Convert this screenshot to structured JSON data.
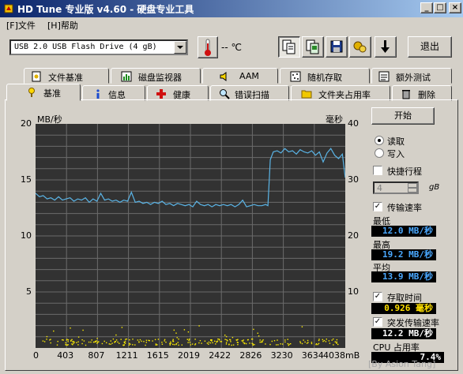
{
  "window": {
    "title": "HD Tune 专业版 v4.60 - 硬盘专业工具",
    "min_label": "_",
    "max_label": "□",
    "close_label": "×"
  },
  "menu": [
    "[F]文件",
    "[H]帮助"
  ],
  "toolbar": {
    "drive_value": "USB 2.0 USB Flash Drive  (4 gB)",
    "temperature": "-- ℃",
    "exit_label": "退出",
    "icons": [
      "copy-text-icon",
      "copy-screen-icon",
      "save-icon",
      "options-icon",
      "download-arrow-icon"
    ]
  },
  "tabs_top": [
    {
      "label": "文件基准",
      "icon": "file-benchmark-icon"
    },
    {
      "label": "磁盘监视器",
      "icon": "disk-monitor-icon"
    },
    {
      "label": "AAM",
      "icon": "speaker-icon"
    },
    {
      "label": "随机存取",
      "icon": "random-access-icon"
    },
    {
      "label": "额外测试",
      "icon": "extra-tests-icon"
    }
  ],
  "tabs_bottom": [
    {
      "label": "基准",
      "icon": "benchmark-icon",
      "active": true
    },
    {
      "label": "信息",
      "icon": "info-icon"
    },
    {
      "label": "健康",
      "icon": "health-cross-icon"
    },
    {
      "label": "错误扫描",
      "icon": "magnifier-icon"
    },
    {
      "label": "文件夹占用率",
      "icon": "folder-icon"
    },
    {
      "label": "删除",
      "icon": "trash-icon"
    }
  ],
  "chart_data": {
    "type": "line",
    "left_axis_label": "MB/秒",
    "right_axis_label": "毫秒",
    "left_ticks": [
      "20",
      "15",
      "10",
      "5"
    ],
    "right_ticks": [
      "40",
      "30",
      "20",
      "10"
    ],
    "ylim_left": [
      0,
      20
    ],
    "ylim_right": [
      0,
      40
    ],
    "x_ticks": [
      "0",
      "403",
      "807",
      "1211",
      "1615",
      "2019",
      "2422",
      "2826",
      "3230",
      "3634",
      "4038mB"
    ],
    "xlim": [
      0,
      4038
    ],
    "series": [
      {
        "name": "传输速率",
        "color": "#5ab4e6",
        "x": [
          0,
          50,
          100,
          150,
          200,
          250,
          300,
          350,
          400,
          450,
          500,
          550,
          600,
          650,
          700,
          750,
          800,
          850,
          900,
          950,
          1000,
          1050,
          1100,
          1150,
          1200,
          1250,
          1300,
          1350,
          1400,
          1450,
          1500,
          1550,
          1600,
          1650,
          1700,
          1750,
          1800,
          1850,
          1900,
          1950,
          2000,
          2050,
          2100,
          2150,
          2200,
          2250,
          2300,
          2350,
          2400,
          2450,
          2500,
          2550,
          2600,
          2650,
          2700,
          2750,
          2800,
          2850,
          2900,
          2950,
          3000,
          3030,
          3060,
          3100,
          3150,
          3200,
          3250,
          3300,
          3350,
          3400,
          3450,
          3500,
          3550,
          3600,
          3650,
          3700,
          3750,
          3800,
          3850,
          3900,
          3950,
          4000,
          4038
        ],
        "y": [
          13.8,
          13.5,
          13.6,
          13.3,
          13.4,
          13.2,
          13.5,
          13.2,
          13.3,
          13.4,
          13.1,
          13.3,
          13.2,
          13.4,
          13.0,
          13.3,
          13.1,
          13.8,
          13.2,
          13.3,
          13.1,
          13.2,
          13.0,
          13.2,
          13.1,
          13.9,
          13.0,
          13.1,
          12.9,
          13.0,
          12.8,
          13.0,
          12.9,
          13.1,
          12.8,
          12.9,
          12.7,
          12.9,
          12.8,
          12.7,
          12.8,
          12.6,
          13.1,
          12.8,
          12.7,
          12.8,
          12.6,
          12.8,
          12.7,
          12.8,
          12.7,
          12.8,
          12.6,
          12.8,
          13.2,
          12.6,
          12.7,
          12.8,
          12.7,
          12.7,
          12.8,
          12.7,
          16.8,
          17.5,
          17.6,
          17.4,
          17.8,
          17.5,
          17.6,
          17.3,
          17.7,
          17.5,
          17.4,
          17.6,
          17.2,
          17.5,
          16.6,
          17.4,
          17.8,
          17.2,
          16.9,
          17.3,
          15.2
        ]
      }
    ],
    "access_time_dots_ms": "near 0.9 ms, along the bottom"
  },
  "controls": {
    "start_label": "开始",
    "read_label": "读取",
    "write_label": "写入",
    "mode": "read",
    "short_stroke_label": "快捷行程",
    "short_stroke_checked": false,
    "short_stroke_value": "4",
    "short_stroke_unit": "gB",
    "transfer_rate_label": "传输速率",
    "transfer_rate_checked": true,
    "min_label": "最低",
    "min_value": "12.0 MB/秒",
    "max_label": "最高",
    "max_value": "19.2 MB/秒",
    "avg_label": "平均",
    "avg_value": "13.9 MB/秒",
    "access_time_label": "存取时间",
    "access_time_checked": true,
    "access_time_value": "0.926 毫秒",
    "burst_label": "突发传输速率",
    "burst_checked": true,
    "burst_value": "12.2 MB/秒",
    "cpu_label": "CPU 占用率",
    "cpu_value": "7.4%",
    "check_mark": "✓"
  },
  "watermark": "[By Asion Tang]",
  "colors": {
    "graph_bg": "#323232",
    "grid": "#6b6b6b",
    "transfer_line": "#5ab4e6",
    "access_dots": "#ffee00",
    "readout_blue": "#4aa8ff",
    "readout_yellow": "#ffe000",
    "thermometer_red": "#d01010"
  }
}
